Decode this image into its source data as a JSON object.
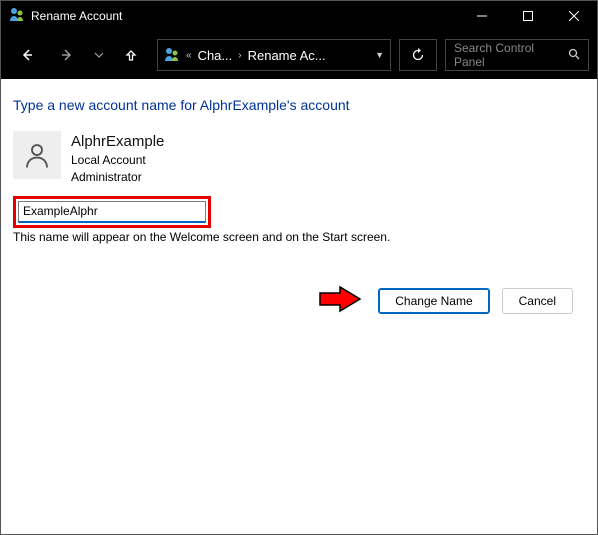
{
  "window": {
    "title": "Rename Account"
  },
  "breadcrumb": {
    "item1": "Cha...",
    "item2": "Rename Ac..."
  },
  "search": {
    "placeholder": "Search Control Panel"
  },
  "page": {
    "heading": "Type a new account name for AlphrExample's account",
    "account": {
      "name": "AlphrExample",
      "type": "Local Account",
      "role": "Administrator"
    },
    "input_value": "ExampleAlphr",
    "hint": "This name will appear on the Welcome screen and on the Start screen.",
    "actions": {
      "change": "Change Name",
      "cancel": "Cancel"
    }
  }
}
